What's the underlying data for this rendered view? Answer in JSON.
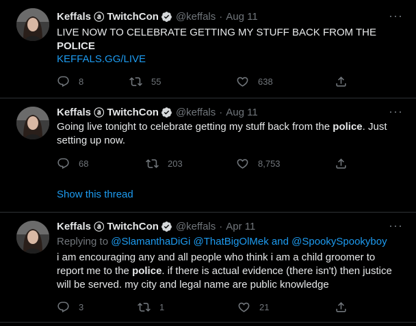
{
  "colors": {
    "background": "#000000",
    "text": "#e7e9ea",
    "muted": "#71767b",
    "accent": "#1d9bf0",
    "border": "#2f3336"
  },
  "tweets": [
    {
      "name": "Keffals",
      "name_badge": "ⓐ",
      "event": "TwitchCon",
      "handle": "@keffals",
      "separator": "·",
      "date": "Aug 11",
      "text_before": "LIVE NOW TO CELEBRATE GETTING MY STUFF BACK FROM THE ",
      "text_bold": "POLICE",
      "text_after": "",
      "link": "KEFFALS.GG/LIVE",
      "replies": "8",
      "retweets": "55",
      "likes": "638"
    },
    {
      "name": "Keffals",
      "name_badge": "ⓐ",
      "event": "TwitchCon",
      "handle": "@keffals",
      "separator": "·",
      "date": "Aug 11",
      "text_before": "Going live tonight to celebrate getting my stuff back from the ",
      "text_bold": "police",
      "text_after": ". Just setting up now.",
      "replies": "68",
      "retweets": "203",
      "likes": "8,753",
      "show_thread": "Show this thread"
    },
    {
      "name": "Keffals",
      "name_badge": "ⓐ",
      "event": "TwitchCon",
      "handle": "@keffals",
      "separator": "·",
      "date": "Apr 11",
      "replying_prefix": "Replying to ",
      "replying_user1": "@SlamanthaDiGi",
      "replying_user2": "@ThatBigOlMek",
      "replying_and": " and ",
      "replying_user3": "@SpookySpookyboy",
      "text_before": "i am encouraging any and all people who think i am a child groomer to report me to the ",
      "text_bold": "police",
      "text_after": ". if there is actual evidence (there isn't) then justice will be served. my city and legal name are public knowledge",
      "replies": "3",
      "retweets": "1",
      "likes": "21"
    }
  ],
  "icons": {
    "more": "more-icon",
    "verified": "verified-badge-icon",
    "reply": "reply-icon",
    "retweet": "retweet-icon",
    "like": "like-icon",
    "share": "share-icon"
  }
}
